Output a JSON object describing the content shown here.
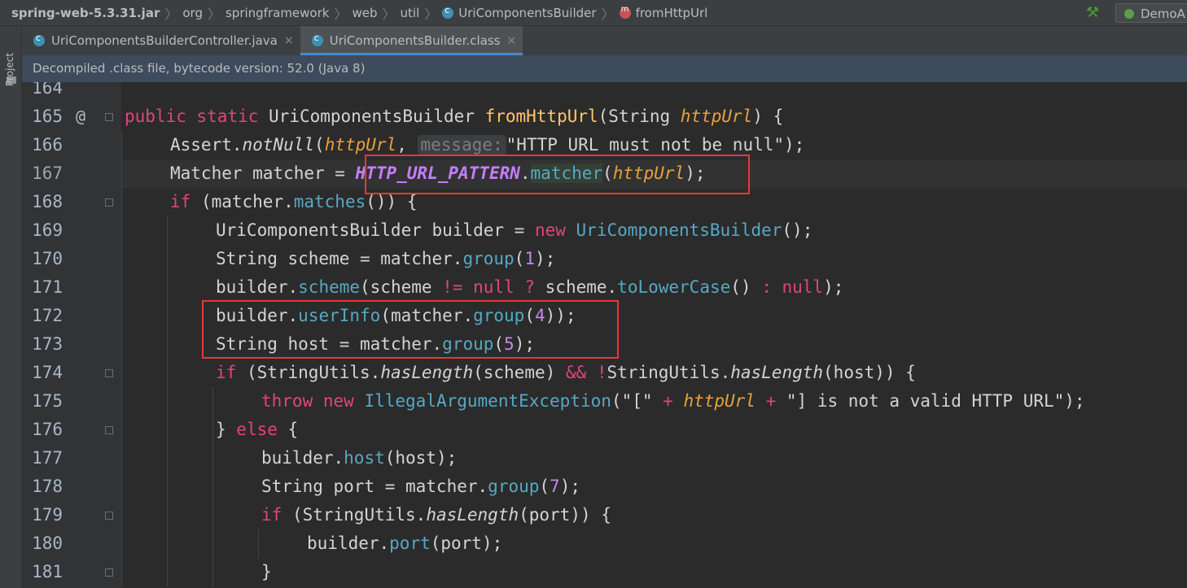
{
  "breadcrumb": {
    "jar": "spring-web-5.3.31.jar",
    "parts": [
      "org",
      "springframework",
      "web",
      "util"
    ],
    "class_name": "UriComponentsBuilder",
    "method_name": "fromHttpUrl"
  },
  "toolbar": {
    "run_config": "DemoA"
  },
  "sidebar": {
    "project_label": "Project"
  },
  "tabs": [
    {
      "label": "UriComponentsBuilderController.java",
      "close": "×",
      "active": false
    },
    {
      "label": "UriComponentsBuilder.class",
      "close": "×",
      "active": true
    }
  ],
  "banner": "Decompiled .class file, bytecode version: 52.0 (Java 8)",
  "gutter": {
    "line_numbers": [
      "164",
      "165",
      "166",
      "167",
      "168",
      "169",
      "170",
      "171",
      "172",
      "173",
      "174",
      "175",
      "176",
      "177",
      "178",
      "179",
      "180",
      "181"
    ],
    "override_marker": "@"
  },
  "colors": {
    "highlight_box": "#E53935",
    "keyword": "#CC7832",
    "method": "#57A8C4",
    "param": "#E6A23C"
  },
  "code": {
    "l164": "",
    "l165": {
      "kw1": "public",
      "kw2": "static",
      "type": "UriComponentsBuilder",
      "name": "fromHttpUrl",
      "open": "(String ",
      "param": "httpUrl",
      "close": ") {"
    },
    "l166": {
      "obj": "Assert.",
      "call": "notNull",
      "open": "(",
      "param": "httpUrl",
      "comma": ", ",
      "hint": "message:",
      "str": "\"HTTP URL must not be null\"",
      "end": ");"
    },
    "l167": {
      "decl": "Matcher matcher = ",
      "const": "HTTP_URL_PATTERN",
      "dot": ".",
      "call_a": "matc",
      "call_b": "her",
      "open": "(",
      "param": "httpUrl",
      "end": ");"
    },
    "l168": {
      "kw": "if",
      "rest_a": " (matcher.",
      "call": "matches",
      "rest_b": "()) {"
    },
    "l169": {
      "decl": "UriComponentsBuilder builder = ",
      "kw": "new",
      "cls": "UriComponentsBuilder",
      "end": "();"
    },
    "l170": {
      "decl": "String scheme = matcher.",
      "call": "group",
      "open": "(",
      "num": "1",
      "end": ");"
    },
    "l171": {
      "obj": "builder.",
      "call": "scheme",
      "mid_a": "(scheme ",
      "op": "!=",
      "kw_null": "null",
      "q": "?",
      "mid_b": " scheme.",
      "call2": "toLowerCase",
      "mid_c": "() ",
      "colon": ":",
      "kw_null2": "null",
      "end": ");"
    },
    "l172": {
      "obj": "builder.",
      "call": "userInfo",
      "mid": "(matcher.",
      "call2": "group",
      "open": "(",
      "num": "4",
      "end": "));"
    },
    "l173": {
      "decl": "String host = matcher.",
      "call": "group",
      "open": "(",
      "num": "5",
      "end": ");"
    },
    "l174": {
      "kw": "if",
      "a": " (StringUtils.",
      "call": "hasLength",
      "b": "(scheme) ",
      "op": "&&",
      "not": "!",
      "c": "StringUtils.",
      "call2": "hasLength",
      "d": "(host)) {"
    },
    "l175": {
      "kw1": "throw",
      "kw2": "new",
      "cls": "IllegalArgumentException",
      "a": "(\"[\" ",
      "plus1": "+",
      "param": "httpUrl",
      "plus2": "+",
      "b": " \"] is not a valid HTTP URL\");"
    },
    "l176": {
      "a": "} ",
      "kw": "else",
      "b": " {"
    },
    "l177": {
      "obj": "builder.",
      "call": "host",
      "end": "(host);"
    },
    "l178": {
      "decl": "String port = matcher.",
      "call": "group",
      "open": "(",
      "num": "7",
      "end": ");"
    },
    "l179": {
      "kw": "if",
      "a": " (StringUtils.",
      "call": "hasLength",
      "b": "(port)) {"
    },
    "l180": {
      "obj": "builder.",
      "call": "port",
      "end": "(port);"
    },
    "l181": {
      "a": "}"
    }
  }
}
